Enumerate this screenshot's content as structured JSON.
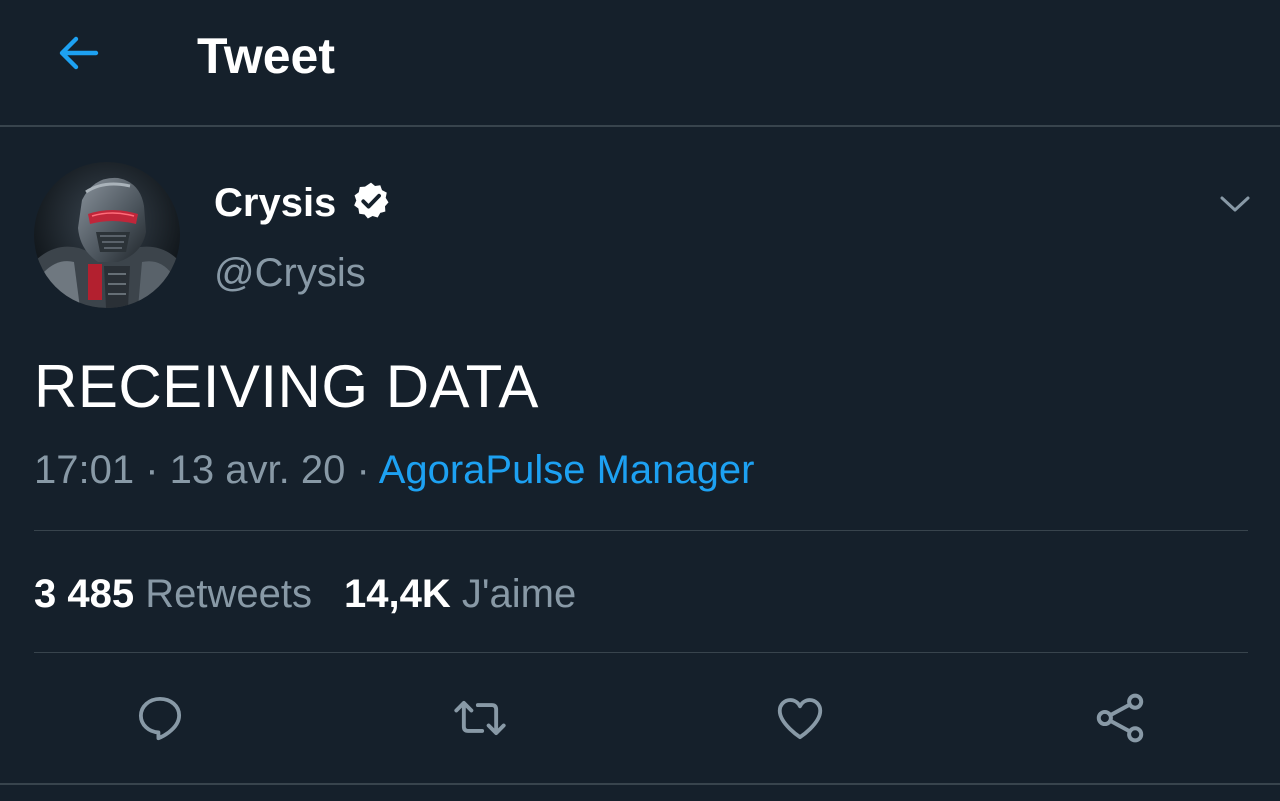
{
  "header": {
    "title": "Tweet",
    "back_icon": "arrow-left-icon"
  },
  "author": {
    "name": "Crysis",
    "handle": "@Crysis",
    "verified": true,
    "avatar": "crysis-nanosuit-avatar"
  },
  "tweet": {
    "text": "RECEIVING DATA",
    "time": "17:01",
    "separator": " · ",
    "date": "13 avr. 20",
    "source": "AgoraPulse Manager"
  },
  "stats": {
    "retweets_count": "3 485",
    "retweets_label": "Retweets",
    "likes_count": "14,4K",
    "likes_label": "J'aime"
  },
  "actions": [
    {
      "name": "reply",
      "icon": "reply-bubble-icon"
    },
    {
      "name": "retweet",
      "icon": "retweet-arrows-icon"
    },
    {
      "name": "like",
      "icon": "heart-icon"
    },
    {
      "name": "share",
      "icon": "share-nodes-icon"
    }
  ],
  "colors": {
    "background": "#15202b",
    "accent": "#1da1f2",
    "secondary_text": "#8899a6",
    "divider": "#38444d"
  }
}
